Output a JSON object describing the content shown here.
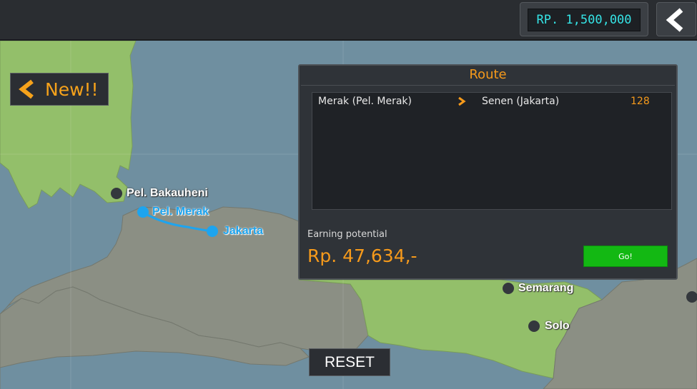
{
  "header": {
    "money": "RP. 1,500,000",
    "back_icon": "chevron-left-icon"
  },
  "new_button": {
    "label": "New!!",
    "icon": "chevron-left-icon"
  },
  "map": {
    "cities": [
      {
        "name": "Pel. Bakauheni",
        "on_route": false
      },
      {
        "name": "Pel. Merak",
        "on_route": true
      },
      {
        "name": "Jakarta",
        "on_route": true
      },
      {
        "name": "Semarang",
        "on_route": false
      },
      {
        "name": "Solo",
        "on_route": false
      }
    ],
    "colors": {
      "sea": "#6f8fa0",
      "land_green": "#93bf6a",
      "land_grey": "#8b8f84",
      "route_line": "#1ea4ee"
    }
  },
  "route_panel": {
    "title": "Route",
    "routes": [
      {
        "from": "Merak (Pel. Merak)",
        "to": "Senen (Jakarta)",
        "distance": "128"
      }
    ],
    "earning_label": "Earning potential",
    "earning_value": "Rp. 47,634,-",
    "go_label": "Go!"
  },
  "reset_label": "RESET",
  "accent_color": "#f69a1b"
}
